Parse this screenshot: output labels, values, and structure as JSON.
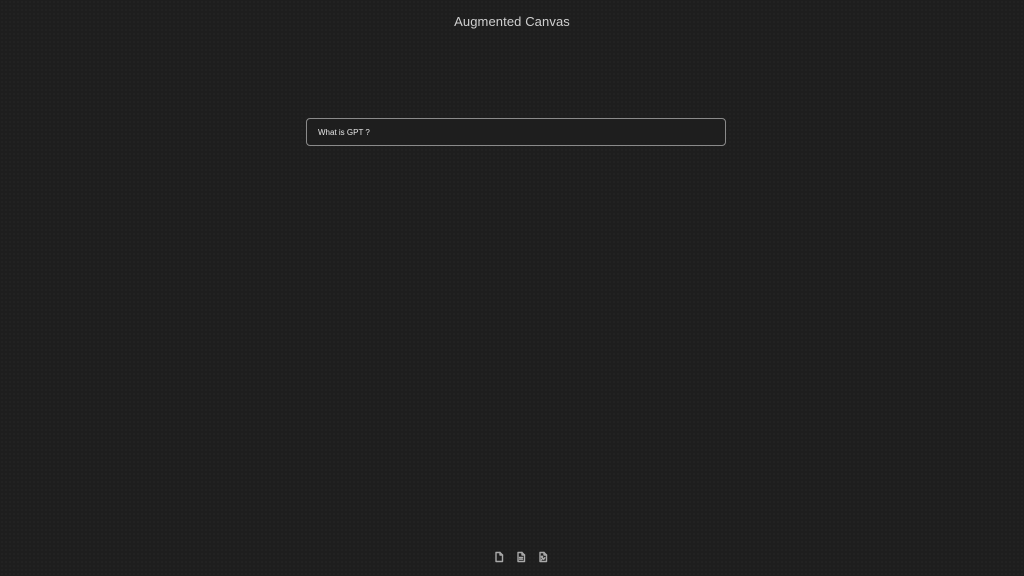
{
  "header": {
    "title": "Augmented Canvas"
  },
  "canvas": {
    "cards": [
      {
        "text": "What is GPT ?"
      }
    ]
  },
  "toolbar": {
    "items": [
      {
        "icon": "new-file-icon"
      },
      {
        "icon": "new-note-icon"
      },
      {
        "icon": "new-media-icon"
      }
    ]
  },
  "colors": {
    "background": "#1e1e1e",
    "card_border": "#8a8a8a",
    "text": "#dcddde"
  }
}
